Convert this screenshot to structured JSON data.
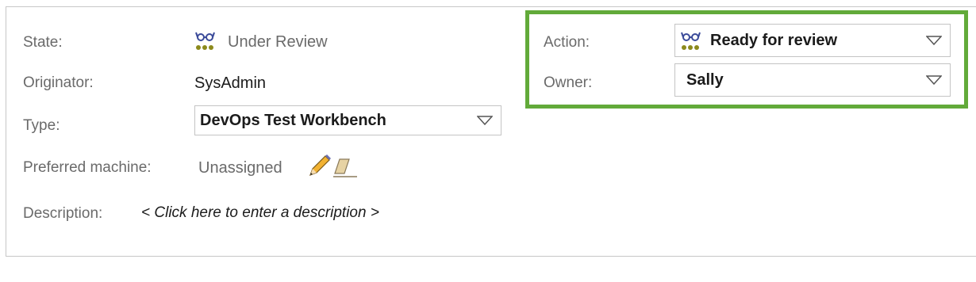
{
  "state": {
    "label": "State:",
    "value": "Under Review",
    "icon": "review-glasses-icon"
  },
  "originator": {
    "label": "Originator:",
    "value": "SysAdmin"
  },
  "type": {
    "label": "Type:",
    "value": "DevOps Test Workbench"
  },
  "preferred_machine": {
    "label": "Preferred machine:",
    "value": "Unassigned",
    "edit_icon": "pencil-icon",
    "clear_icon": "eraser-icon"
  },
  "description": {
    "label": "Description:",
    "placeholder": "< Click here to enter a description >"
  },
  "action": {
    "label": "Action:",
    "value": "Ready for review",
    "icon": "review-glasses-icon"
  },
  "owner": {
    "label": "Owner:",
    "value": "Sally"
  },
  "colors": {
    "highlight": "#62aa3a",
    "icon_blue": "#3b4b9a",
    "icon_olive": "#8c8a1c"
  }
}
